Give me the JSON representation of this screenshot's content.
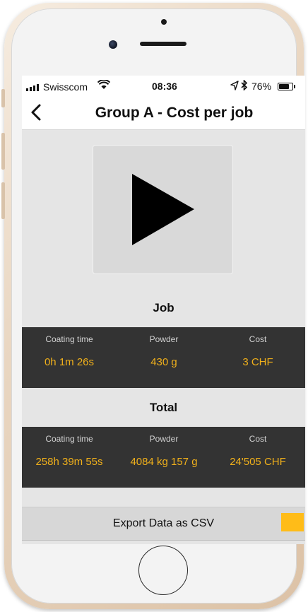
{
  "status_bar": {
    "carrier": "Swisscom",
    "time": "08:36",
    "battery": "76%",
    "battery_level": 0.76,
    "icons": [
      "signal-icon",
      "wifi-icon",
      "location-arrow-icon",
      "bluetooth-icon",
      "battery-icon"
    ]
  },
  "nav": {
    "back_icon": "chevron-left-icon",
    "title": "Group A - Cost per job"
  },
  "play": {
    "icon": "play-icon"
  },
  "job": {
    "title": "Job",
    "columns": [
      {
        "label": "Coating time",
        "value": "0h 1m 26s"
      },
      {
        "label": "Powder",
        "value": "430 g"
      },
      {
        "label": "Cost",
        "value": "3 CHF"
      }
    ]
  },
  "total": {
    "title": "Total",
    "columns": [
      {
        "label": "Coating time",
        "value": "258h 39m 55s"
      },
      {
        "label": "Powder",
        "value": "4084 kg 157 g"
      },
      {
        "label": "Cost",
        "value": "24'505 CHF"
      }
    ]
  },
  "export": {
    "label": "Export Data as CSV"
  },
  "colors": {
    "accent": "#f0b01b",
    "panel_bg": "#333333",
    "screen_bg": "#e5e5e5"
  }
}
